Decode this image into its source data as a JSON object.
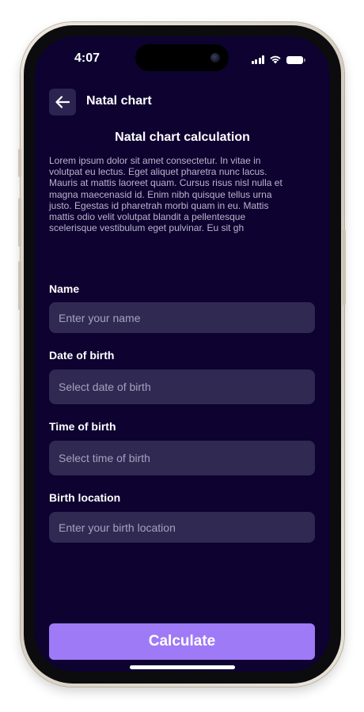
{
  "status_bar": {
    "time": "4:07"
  },
  "header": {
    "title": "Natal chart"
  },
  "content": {
    "title": "Natal chart calculation",
    "description_lines": [
      "Lorem ipsum dolor sit amet consectetur. In vitae in",
      "volutpat eu lectus. Eget aliquet pharetra nunc lacus.",
      "Mauris at mattis laoreet quam. Cursus risus nisl nulla et",
      "magna maecenasid id. Enim nibh quisque tellus urna",
      "justo. Egestas id pharetrah morbi quam in eu. Mattis",
      "mattis odio velit volutpat blandit a pellentesque",
      "scelerisque vestibulum eget pulvinar. Eu sit gh"
    ]
  },
  "form": {
    "name": {
      "label": "Name",
      "placeholder": "Enter your name",
      "value": ""
    },
    "date_of_birth": {
      "label": "Date of birth",
      "placeholder": "Select date of birth",
      "value": ""
    },
    "time_of_birth": {
      "label": "Time of birth",
      "placeholder": "Select time of birth",
      "value": ""
    },
    "birth_location": {
      "label": "Birth location",
      "placeholder": "Enter your birth location",
      "value": ""
    }
  },
  "actions": {
    "calculate_label": "Calculate"
  },
  "colors": {
    "background": "#0d0230",
    "field": "#302952",
    "accent": "#9f7af6",
    "back_button": "#2b2450"
  },
  "icons": {
    "back": "arrow-left-icon",
    "signal": "cellular-signal-icon",
    "wifi": "wifi-icon",
    "battery": "battery-icon"
  }
}
